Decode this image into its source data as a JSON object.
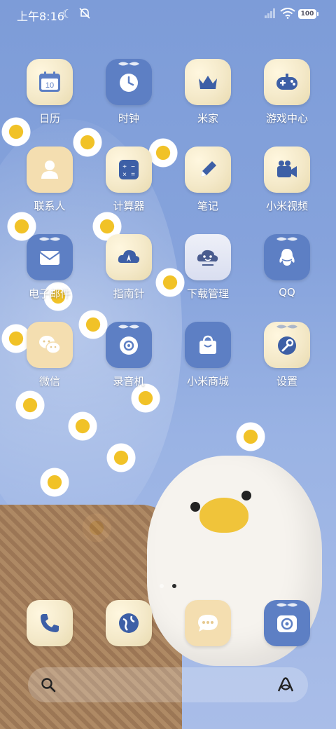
{
  "status_bar": {
    "time": "上午8:16",
    "battery": "100"
  },
  "apps": [
    {
      "label": "日历",
      "icon": "calendar-icon",
      "badge_text": "10"
    },
    {
      "label": "时钟",
      "icon": "clock-icon"
    },
    {
      "label": "米家",
      "icon": "home-crown-icon"
    },
    {
      "label": "游戏中心",
      "icon": "gamepad-icon"
    },
    {
      "label": "联系人",
      "icon": "person-icon"
    },
    {
      "label": "计算器",
      "icon": "calculator-icon"
    },
    {
      "label": "笔记",
      "icon": "pencil-icon"
    },
    {
      "label": "小米视频",
      "icon": "video-camera-icon"
    },
    {
      "label": "电子邮件",
      "icon": "envelope-icon"
    },
    {
      "label": "指南针",
      "icon": "compass-icon"
    },
    {
      "label": "下载管理",
      "icon": "download-cloud-icon"
    },
    {
      "label": "QQ",
      "icon": "qq-icon"
    },
    {
      "label": "微信",
      "icon": "wechat-icon"
    },
    {
      "label": "录音机",
      "icon": "recorder-icon"
    },
    {
      "label": "小米商城",
      "icon": "shopping-bag-icon"
    },
    {
      "label": "设置",
      "icon": "wrench-icon"
    }
  ],
  "dock": [
    {
      "icon": "phone-icon"
    },
    {
      "icon": "browser-icon"
    },
    {
      "icon": "message-icon"
    },
    {
      "icon": "camera-icon"
    }
  ],
  "colors": {
    "icon_blue": "#5d7fc4",
    "icon_cream": "#f4deb0",
    "label": "#ffffff"
  }
}
